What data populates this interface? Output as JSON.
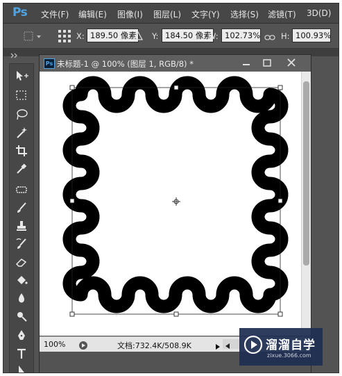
{
  "app": {
    "logo": "Ps"
  },
  "menu": {
    "items": [
      "文件(F)",
      "编辑(E)",
      "图像(I)",
      "图层(L)",
      "文字(Y)",
      "选择(S)",
      "滤镜(T)",
      "3D(D)"
    ]
  },
  "options": {
    "x_label": "X:",
    "x_value": "189.50 像素",
    "y_label": "Y:",
    "y_value": "184.50 像素",
    "w_label": "W:",
    "w_value": "102.73%",
    "h_label": "H:",
    "h_value": "100.93%"
  },
  "document": {
    "icon": "Ps",
    "title": "未标题-1 @ 100% (图层 1, RGB/8) *"
  },
  "status": {
    "zoom": "100%",
    "doc_info": "文档:732.4K/508.9K"
  },
  "tools": [
    {
      "name": "move-tool-icon"
    },
    {
      "name": "marquee-tool-icon"
    },
    {
      "name": "lasso-tool-icon"
    },
    {
      "name": "magic-wand-icon"
    },
    {
      "name": "crop-tool-icon"
    },
    {
      "name": "eyedropper-icon"
    },
    {
      "name": "healing-brush-icon"
    },
    {
      "name": "brush-tool-icon"
    },
    {
      "name": "clone-stamp-icon"
    },
    {
      "name": "history-brush-icon"
    },
    {
      "name": "eraser-icon"
    },
    {
      "name": "paint-bucket-icon"
    },
    {
      "name": "blur-tool-icon"
    },
    {
      "name": "dodge-tool-icon"
    },
    {
      "name": "pen-tool-icon"
    },
    {
      "name": "type-tool-icon"
    },
    {
      "name": "path-selection-icon"
    }
  ],
  "watermark": {
    "brand": "溜溜自学",
    "url": "zixue.3066.com"
  },
  "colors": {
    "ui_dark": "#535353",
    "menubar": "#474747",
    "ps_blue": "#4fa3e0",
    "canvas": "#ffffff",
    "shape": "#000000"
  }
}
